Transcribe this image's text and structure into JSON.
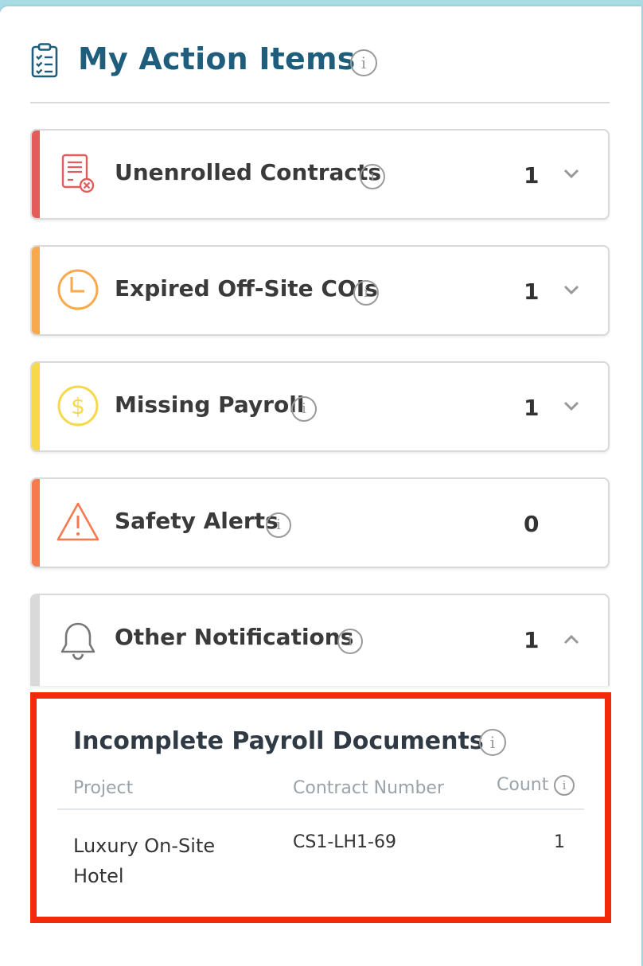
{
  "header": {
    "title": "My Action Items",
    "info_glyph": "i"
  },
  "cards": [
    {
      "label": "Unenrolled Contracts",
      "count": "1",
      "color": "#e35b5b",
      "icon": "contract-x-icon",
      "chevron": "down"
    },
    {
      "label": "Expired Off-Site COIs",
      "count": "1",
      "color": "#f8a94b",
      "icon": "clock-icon",
      "chevron": "down"
    },
    {
      "label": "Missing Payroll",
      "count": "1",
      "color": "#f6d84a",
      "icon": "dollar-icon",
      "chevron": "down"
    },
    {
      "label": "Safety Alerts",
      "count": "0",
      "color": "#f7794e",
      "icon": "warning-icon",
      "chevron": "none"
    },
    {
      "label": "Other Notifications",
      "count": "1",
      "color": "#d9d9d9",
      "icon": "bell-icon",
      "chevron": "up"
    }
  ],
  "notifications_panel": {
    "title": "Incomplete Payroll Documents",
    "columns": [
      "Project",
      "Contract Number",
      "Count"
    ],
    "rows": [
      {
        "project": "Luxury On-Site Hotel",
        "contract_number": "CS1-LH1-69",
        "count": "1"
      }
    ],
    "highlight_color": "#f22a0c"
  },
  "colors": {
    "title": "#1e5e7c",
    "background": "#a9dbe4"
  }
}
